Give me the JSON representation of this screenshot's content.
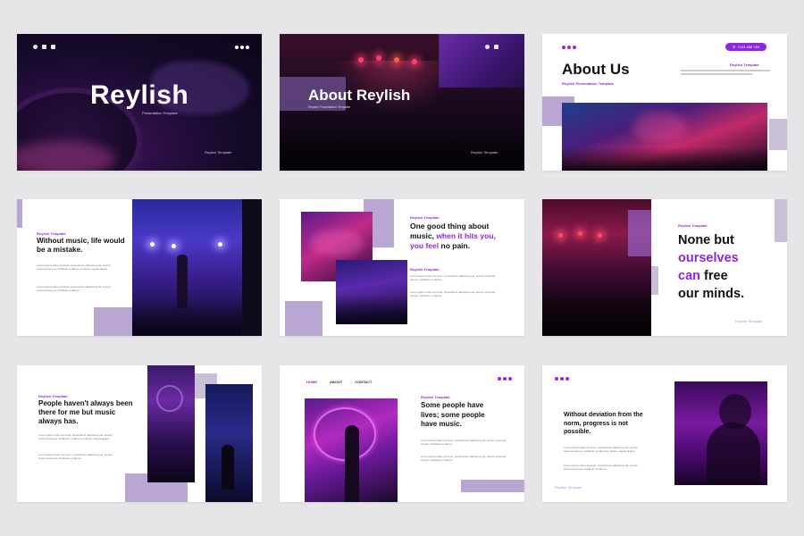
{
  "slide1": {
    "title": "Reylish",
    "subtitle": "Presentation Template",
    "footer": "Reylish Template"
  },
  "slide2": {
    "title": "About Reylish",
    "subtitle": "Reylish Presentation Template",
    "footer": "Reylish Template"
  },
  "slide3": {
    "title": "About Us",
    "subtitle": "Reylish Presentation Template",
    "phone": "+123 456 789",
    "label": "Reylish Template"
  },
  "slide4": {
    "label": "Reylish Template",
    "heading": "Without music, life would be a mistake.",
    "para1": "Lorem ipsum dolor sit amet, consectetur adipiscing elit, sed do eiusmod tempor incididunt ut labore et dolore magna aliqua.",
    "para2": "Lorem ipsum dolor sit amet, consectetur adipiscing elit, sed do eiusmod tempor incididunt ut labore."
  },
  "slide5": {
    "label": "Reylish Template",
    "heading_a": "One good thing about music,",
    "heading_b": "when it hits you, you feel",
    "heading_c": "no pain.",
    "label2": "Reylish Template",
    "para1": "Lorem ipsum dolor sit amet, consectetur adipiscing elit, sed do eiusmod tempor incididunt ut labore.",
    "para2": "Lorem ipsum dolor sit amet, consectetur adipiscing elit, sed do eiusmod tempor incididunt ut labore."
  },
  "slide6": {
    "label": "Reylish Template",
    "line1": "None but",
    "line2": "ourselves",
    "line3a": "can",
    "line3b": "free",
    "line4": "our minds.",
    "footer": "Reylish Template"
  },
  "slide7": {
    "label": "Reylish Template",
    "heading": "People haven't always been there for me but music always has.",
    "para1": "Lorem ipsum dolor sit amet, consectetur adipiscing elit, sed do eiusmod tempor incididunt ut labore et dolore magna aliqua.",
    "para2": "Lorem ipsum dolor sit amet, consectetur adipiscing elit, sed do eiusmod tempor incididunt ut labore."
  },
  "slide8": {
    "nav": [
      "HOME",
      "ABOUT",
      "CONTACT"
    ],
    "label": "Reylish Template",
    "heading": "Some people have lives; some people have music.",
    "para1": "Lorem ipsum dolor sit amet, consectetur adipiscing elit, sed do eiusmod tempor incididunt ut labore.",
    "para2": "Lorem ipsum dolor sit amet, consectetur adipiscing elit, sed do eiusmod tempor incididunt ut labore."
  },
  "slide9": {
    "heading": "Without deviation from the norm, progress is not possible.",
    "para1": "Lorem ipsum dolor sit amet, consectetur adipiscing elit, sed do eiusmod tempor incididunt ut labore et dolore magna aliqua.",
    "para2": "Lorem ipsum dolor sit amet, consectetur adipiscing elit, sed do eiusmod tempor incididunt ut labore.",
    "footer": "Reylish Template"
  },
  "colors": {
    "accent": "#8e27e0",
    "lilac": "#b9a6d3",
    "dark": "#120820",
    "page_bg": "#e6e6e8"
  },
  "icons": [
    "instagram-icon",
    "twitter-icon",
    "facebook-icon",
    "phone-icon",
    "menu-dots-icon"
  ]
}
